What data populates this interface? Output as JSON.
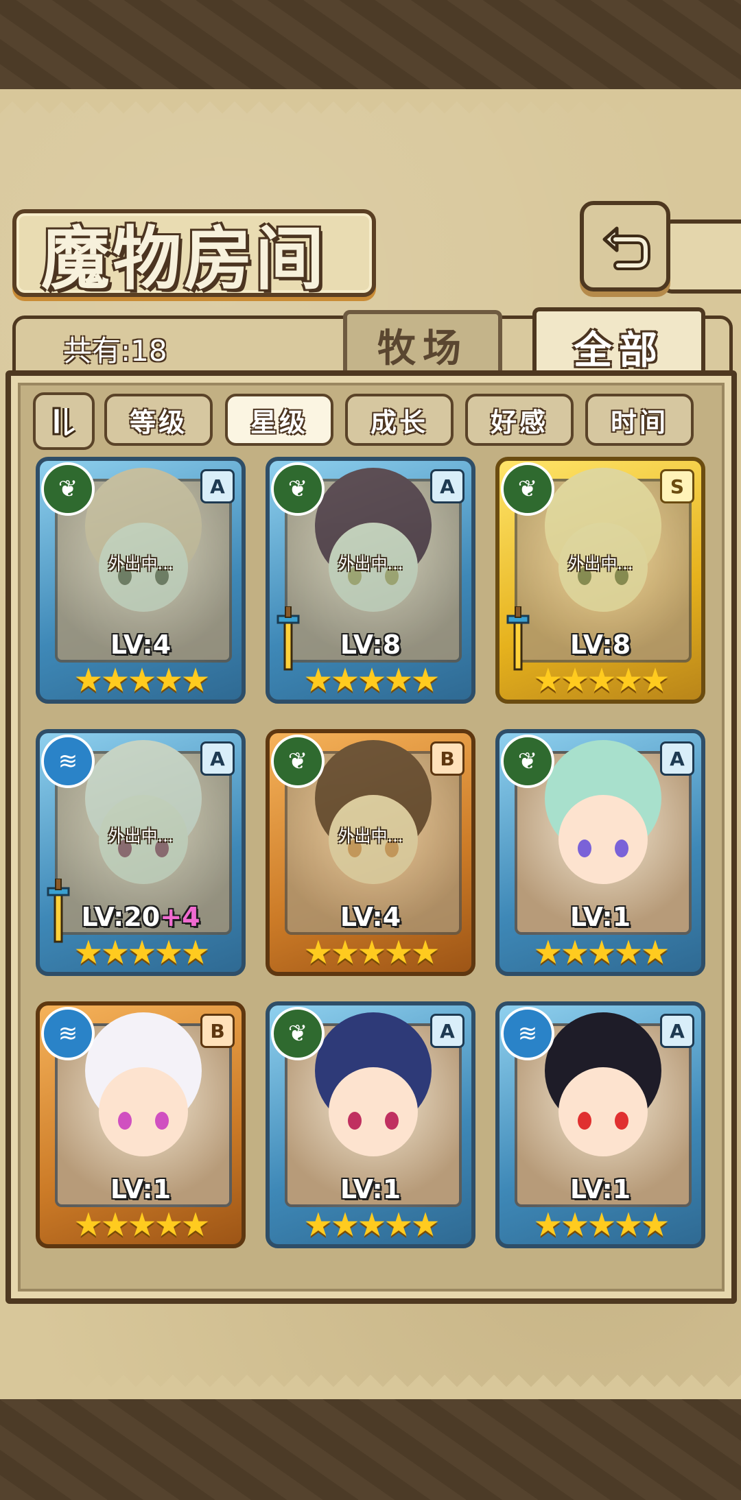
{
  "header": {
    "title": "魔物房间",
    "back_icon": "return-arrow-icon"
  },
  "tabs": {
    "count_label": "共有:18",
    "farm": "牧场",
    "all": "全部",
    "active": "all"
  },
  "filters": {
    "toggle_icon": "filter-toggle-icon",
    "sort_buttons": [
      "等级",
      "星级",
      "成长",
      "好感",
      "时间"
    ],
    "active_sort": "星级"
  },
  "monsters": [
    {
      "rank": "A",
      "element": "leaf",
      "level_text": "LV:4",
      "bonus": "",
      "status": "外出中...",
      "stars": "★★★★★",
      "equipped": false
    },
    {
      "rank": "A",
      "element": "leaf",
      "level_text": "LV:8",
      "bonus": "",
      "status": "外出中...",
      "stars": "★★★★★",
      "equipped": true
    },
    {
      "rank": "S",
      "element": "leaf",
      "level_text": "LV:8",
      "bonus": "",
      "status": "外出中...",
      "stars": "★★★★★",
      "equipped": true
    },
    {
      "rank": "A",
      "element": "water",
      "level_text": "LV:20",
      "bonus": "+4",
      "status": "外出中...",
      "stars": "★★★★★",
      "equipped": true
    },
    {
      "rank": "B",
      "element": "leaf",
      "level_text": "LV:4",
      "bonus": "",
      "status": "外出中...",
      "stars": "★★★★★",
      "equipped": false
    },
    {
      "rank": "A",
      "element": "leaf",
      "level_text": "LV:1",
      "bonus": "",
      "status": "",
      "stars": "★★★★★",
      "equipped": false
    },
    {
      "rank": "B",
      "element": "water",
      "level_text": "LV:1",
      "bonus": "",
      "status": "",
      "stars": "★★★★★",
      "equipped": false
    },
    {
      "rank": "A",
      "element": "leaf",
      "level_text": "LV:1",
      "bonus": "",
      "status": "",
      "stars": "★★★★★",
      "equipped": false
    },
    {
      "rank": "A",
      "element": "water",
      "level_text": "LV:1",
      "bonus": "",
      "status": "",
      "stars": "★★★★★",
      "equipped": false
    }
  ],
  "colors": {
    "parchment": "#d8c79a",
    "frame": "#4e3820",
    "rank_a": "#3e88b7",
    "rank_s": "#e6b21d",
    "rank_b": "#cc7b27",
    "star": "#ffcb1f"
  }
}
